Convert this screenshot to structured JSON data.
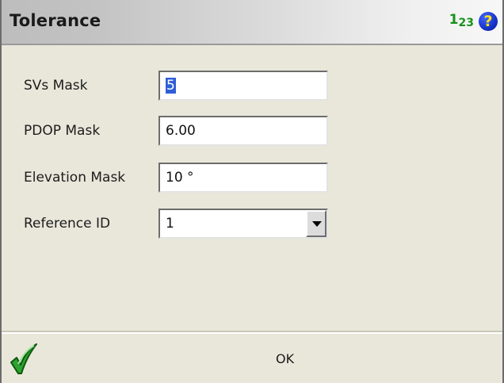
{
  "header": {
    "title": "Tolerance",
    "input_mode_digits": [
      "1",
      "2",
      "3"
    ],
    "help_glyph": "?",
    "icons": {
      "input_mode": "numeric-input-icon",
      "help": "help-icon"
    },
    "colors": {
      "input_mode": "#17931a",
      "help_bg": "#1632c8",
      "help_fg": "#ffe21a"
    }
  },
  "form": {
    "svs_mask": {
      "label": "SVs Mask",
      "value": "5"
    },
    "pdop_mask": {
      "label": "PDOP Mask",
      "value": "6.00"
    },
    "elevation_mask": {
      "label": "Elevation Mask",
      "value": "10 °"
    },
    "reference_id": {
      "label": "Reference ID",
      "value": "1"
    }
  },
  "footer": {
    "ok_label": "OK",
    "ok_icon": "green-checkmark-icon"
  },
  "colors": {
    "background": "#e9e7da",
    "selection": "#2f5fd6",
    "checkmark": "#2fa12f"
  }
}
